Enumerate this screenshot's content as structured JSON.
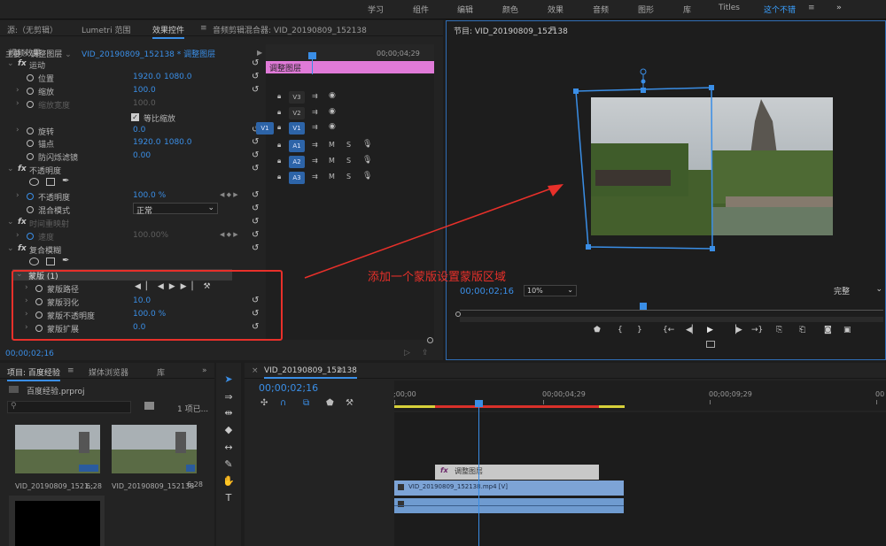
{
  "workspaces": [
    "学习",
    "组件",
    "编辑",
    "颜色",
    "效果",
    "音频",
    "图形",
    "库",
    "Titles",
    "这个不错",
    "≡",
    "»"
  ],
  "source_panel": {
    "tabs": [
      "源:（无剪辑）",
      "Lumetri 范围",
      "效果控件",
      "≡",
      "音频剪辑混合器: VID_20190809_152138"
    ],
    "breadcrumb_main": "主要 * 调整图层",
    "breadcrumb_clip": "VID_20190809_152138 * 调整图层",
    "clip_label": "调整图层",
    "ruler_time": "00;00;04;29",
    "section": "视频效果",
    "rows": [
      {
        "name": "运动",
        "type": "fx"
      },
      {
        "name": "位置",
        "v1": "1920.0",
        "v2": "1080.0"
      },
      {
        "name": "缩放",
        "v1": "100.0"
      },
      {
        "name": "缩放宽度",
        "v1": "100.0",
        "disabled": true
      },
      {
        "name": "等比缩放",
        "type": "check"
      },
      {
        "name": "旋转",
        "v1": "0.0"
      },
      {
        "name": "锚点",
        "v1": "1920.0",
        "v2": "1080.0"
      },
      {
        "name": "防闪烁滤镜",
        "v1": "0.00"
      },
      {
        "name": "不透明度",
        "type": "fx"
      },
      {
        "name": "",
        "type": "shapes"
      },
      {
        "name": "不透明度",
        "v1": "100.0 %"
      },
      {
        "name": "混合模式",
        "v1": "正常"
      },
      {
        "name": "时间重映射",
        "type": "fx",
        "disabled": true
      },
      {
        "name": "速度",
        "v1": "100.00%",
        "disabled": true
      },
      {
        "name": "复合模糊",
        "type": "fx"
      },
      {
        "name": "",
        "type": "shapes"
      },
      {
        "name": "蒙版 (1)",
        "type": "mask"
      },
      {
        "name": "蒙版路径",
        "type": "path"
      },
      {
        "name": "蒙版羽化",
        "v1": "10.0"
      },
      {
        "name": "蒙版不透明度",
        "v1": "100.0 %"
      },
      {
        "name": "蒙版扩展",
        "v1": "0.0"
      }
    ],
    "timecode": "00;00;02;16"
  },
  "program": {
    "title": "节目: VID_20190809_152138",
    "menu": "≡",
    "timecode": "00;00;02;16",
    "zoom": "10%",
    "quality": "完整",
    "annotation": "添加一个蒙版设置蒙版区域"
  },
  "project": {
    "tabs": [
      "项目: 百度经验",
      "≡",
      "媒体浏览器",
      "库",
      "»"
    ],
    "file": "百度经验.prproj",
    "count": "1 项已...",
    "items": [
      {
        "name": "VID_20190809_1521...",
        "dur": "6;28"
      },
      {
        "name": "VID_20190809_152138",
        "dur": "6;28"
      }
    ]
  },
  "timeline": {
    "tab": "VID_20190809_152138",
    "menu": "≡",
    "timecode": "00;00;02;16",
    "ruler": [
      ";00;00",
      "00;00;04;29",
      "00;00;09;29",
      "00"
    ],
    "tracks": [
      {
        "toggle": "",
        "name": "V3"
      },
      {
        "toggle": "",
        "name": "V2"
      },
      {
        "toggle": "V1",
        "name": "V1"
      },
      {
        "toggle": "",
        "name": "A1"
      },
      {
        "toggle": "",
        "name": "A2"
      },
      {
        "toggle": "",
        "name": "A3"
      }
    ],
    "adj_clip": "调整图层",
    "video_clip": "VID_20190809_152138.mp4 [V]",
    "m": "M",
    "s": "S"
  },
  "colors": {
    "accent": "#3a8ee6",
    "annotation": "#e8302a",
    "adjustment": "#e07ad8"
  }
}
